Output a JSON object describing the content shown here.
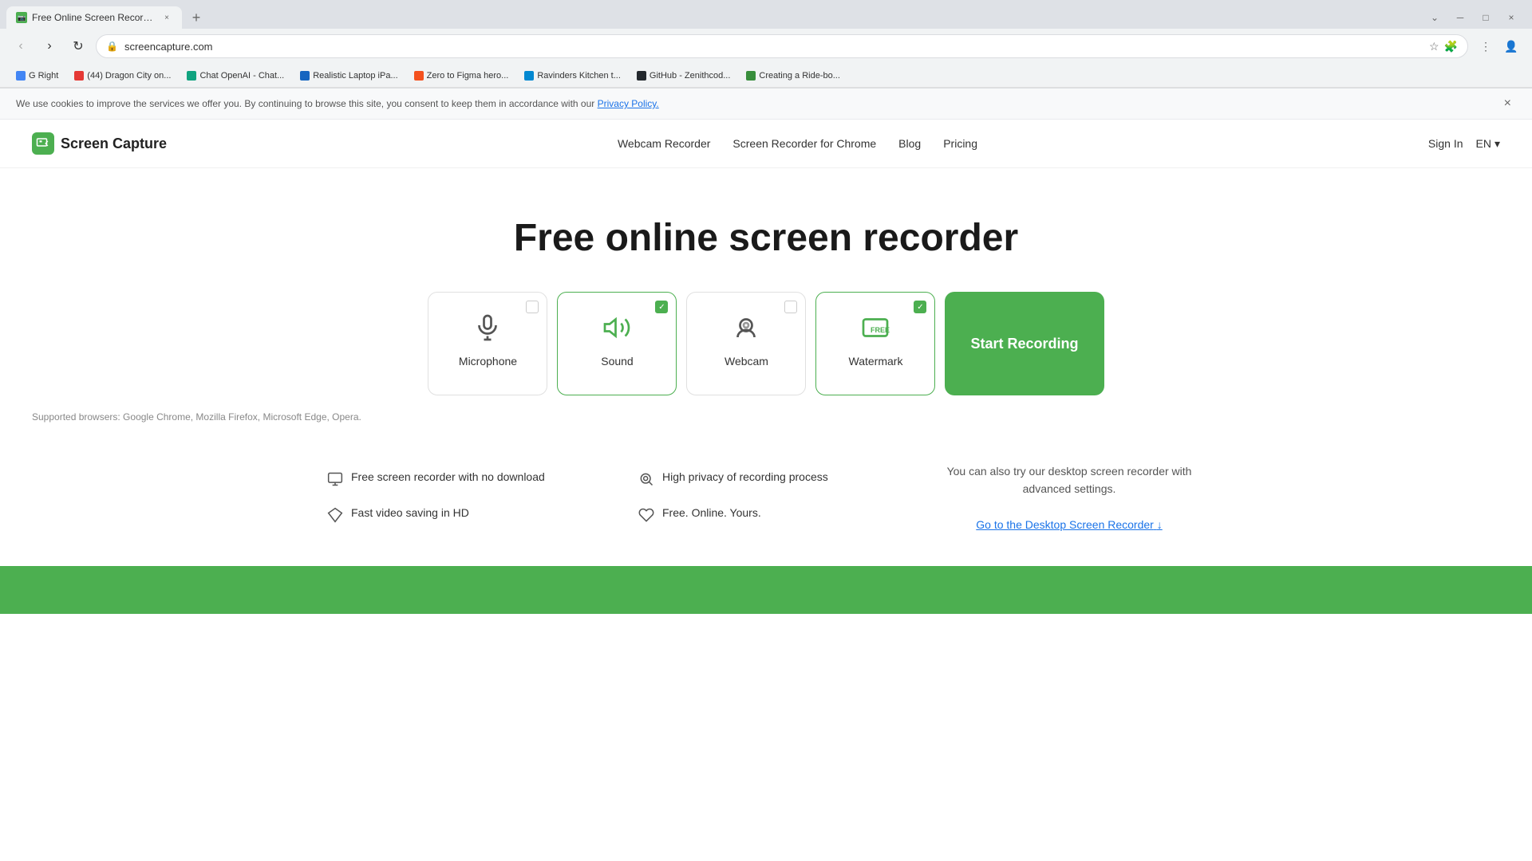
{
  "browser": {
    "tab_title": "Free Online Screen Recorder | C...",
    "tab_new": "+",
    "address": "screencapture.com",
    "bookmarks": [
      {
        "label": "G Right",
        "color": "#4285f4"
      },
      {
        "label": "(44) Dragon City on...",
        "color": "#e53935"
      },
      {
        "label": "Chat OpenAI - Chat...",
        "color": "#10a37f"
      },
      {
        "label": "Realistic Laptop iPa...",
        "color": "#1565c0"
      },
      {
        "label": "Zero to Figma hero...",
        "color": "#f4511e"
      },
      {
        "label": "Ravinders Kitchen t...",
        "color": "#0288d1"
      },
      {
        "label": "GitHub - Zenithcod...",
        "color": "#24292e"
      },
      {
        "label": "Creating a Ride-bo...",
        "color": "#388e3c"
      }
    ]
  },
  "cookie_banner": {
    "text": "We use cookies to improve the services we offer you. By continuing to browse this site, you consent to keep them in accordance with our",
    "link_text": "Privacy Policy.",
    "close": "×"
  },
  "header": {
    "logo_text": "Screen Capture",
    "nav_items": [
      "Webcam Recorder",
      "Screen Recorder for Chrome",
      "Blog",
      "Pricing",
      "Sign In"
    ],
    "lang": "EN"
  },
  "hero": {
    "title": "Free online screen recorder",
    "options": [
      {
        "id": "microphone",
        "label": "Microphone",
        "checked": false
      },
      {
        "id": "sound",
        "label": "Sound",
        "checked": true
      },
      {
        "id": "webcam",
        "label": "Webcam",
        "checked": false
      },
      {
        "id": "watermark",
        "label": "Watermark",
        "checked": true
      }
    ],
    "start_btn": "Start Recording",
    "supported_text": "Supported browsers: Google Chrome, Mozilla Firefox, Microsoft Edge, Opera."
  },
  "features": [
    {
      "icon": "monitor-icon",
      "text": "Free screen recorder with no download"
    },
    {
      "icon": "privacy-icon",
      "text": "High privacy of recording process"
    },
    {
      "icon": "diamond-icon",
      "text": "Fast video saving in HD"
    },
    {
      "icon": "heart-icon",
      "text": "Free. Online. Yours."
    }
  ],
  "desktop_section": {
    "text": "You can also try our desktop screen recorder with advanced settings.",
    "link_text": "Go to the Desktop Screen Recorder",
    "link_arrow": "↓"
  }
}
